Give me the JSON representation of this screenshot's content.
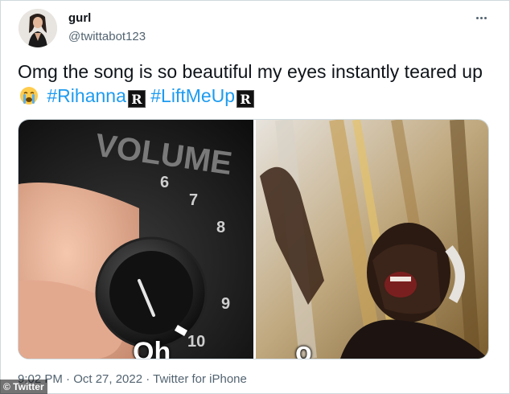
{
  "user": {
    "display_name": "gurl",
    "handle": "@twittabot123",
    "avatar_icon": "avatar-photo"
  },
  "tweet": {
    "text_main": "Omg the song is so beautiful my eyes instantly teared up",
    "emoji": "crying-face-icon",
    "hashtags": [
      "#Rihanna",
      "#LiftMeUp"
    ],
    "hashtag_badge": "R",
    "hashtag_color": "#1d9bf0"
  },
  "media": {
    "left_image": {
      "knob_label": "VOLUME",
      "dial_numbers": [
        "6",
        "7",
        "8",
        "9",
        "10"
      ],
      "caption_fragment": "Oh"
    },
    "right_image": {
      "caption_fragment": "o"
    }
  },
  "meta": {
    "timestamp": "9:02 PM · Oct 27, 2022 · Twitter for iPhone"
  },
  "watermark": "© Twitter"
}
